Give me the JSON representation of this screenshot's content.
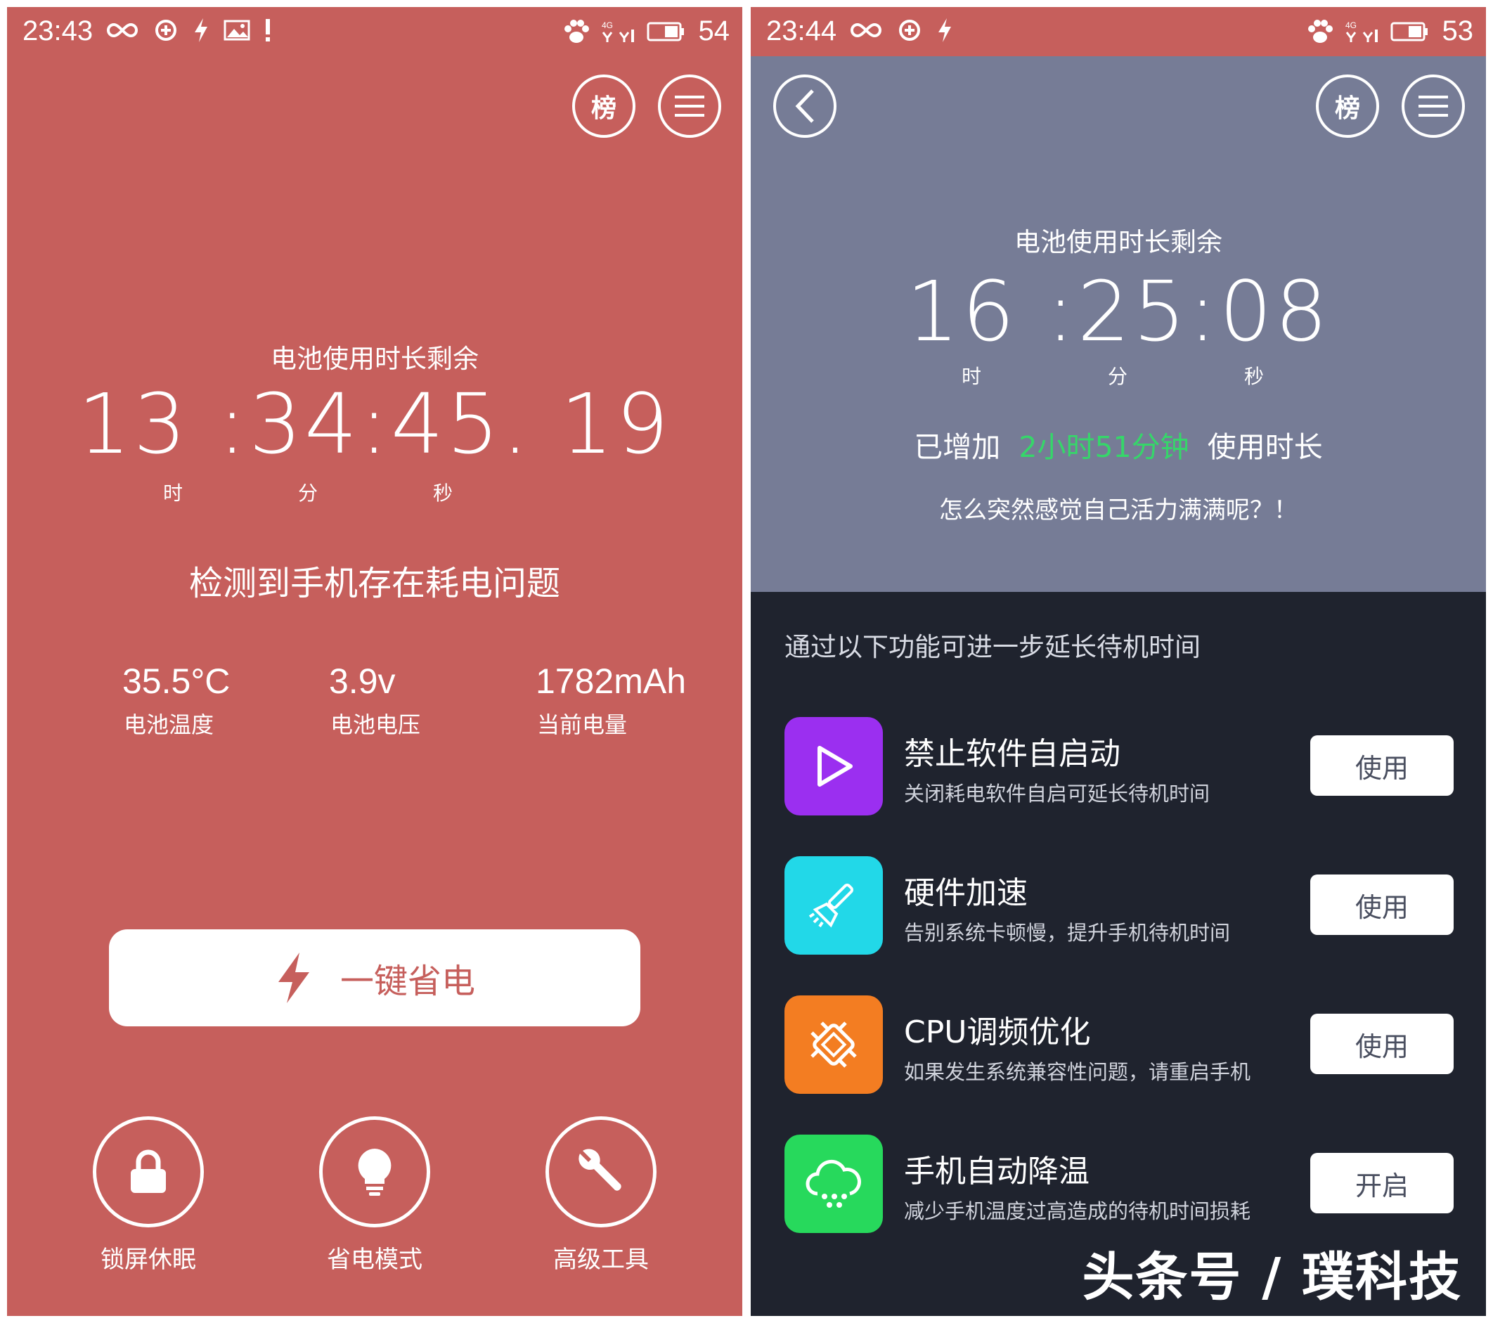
{
  "left": {
    "status": {
      "time": "23:43",
      "battery_pct": "54",
      "network": "4G"
    },
    "header": {
      "rank_label": "榜"
    },
    "timer": {
      "label": "电池使用时长剩余",
      "value": "13 :34:45. 19",
      "units": [
        "时",
        "分",
        "秒"
      ]
    },
    "warning": "检测到手机存在耗电问题",
    "stats": [
      {
        "value": "35.5°C",
        "label": "电池温度"
      },
      {
        "value": "3.9v",
        "label": "电池电压"
      },
      {
        "value": "1782mAh",
        "label": "当前电量"
      }
    ],
    "save_button": "一键省电",
    "tools": [
      {
        "label": "锁屏休眠",
        "icon": "lock-icon"
      },
      {
        "label": "省电模式",
        "icon": "lightbulb-icon"
      },
      {
        "label": "高级工具",
        "icon": "wrench-icon"
      }
    ],
    "colors": {
      "background": "#c65f5c"
    }
  },
  "right": {
    "status": {
      "time": "23:44",
      "battery_pct": "53",
      "network": "4G"
    },
    "header": {
      "rank_label": "榜"
    },
    "timer": {
      "label": "电池使用时长剩余",
      "value": "16 :25:08",
      "units": [
        "时",
        "分",
        "秒"
      ]
    },
    "added": {
      "prefix": "已增加",
      "amount": "2小时51分钟",
      "suffix": "使用时长"
    },
    "tagline": "怎么突然感觉自己活力满满呢？！",
    "section_title": "通过以下功能可进一步延长待机时间",
    "features": [
      {
        "title": "禁止软件自启动",
        "desc": "关闭耗电软件自启可延长待机时间",
        "button": "使用",
        "icon": "play-icon",
        "color": "#9b2ff0"
      },
      {
        "title": "硬件加速",
        "desc": "告别系统卡顿慢，提升手机待机时间",
        "button": "使用",
        "icon": "broom-icon",
        "color": "#22d8e8"
      },
      {
        "title": "CPU调频优化",
        "desc": "如果发生系统兼容性问题，请重启手机",
        "button": "使用",
        "icon": "chip-icon",
        "color": "#f37d22"
      },
      {
        "title": "手机自动降温",
        "desc": "减少手机温度过高造成的待机时间损耗",
        "button": "开启",
        "icon": "cloud-icon",
        "color": "#27d95c"
      }
    ],
    "watermark": "头条号 / 璞科技",
    "colors": {
      "top": "#767c96",
      "bottom": "#1f232e",
      "accent": "#36d66a"
    }
  }
}
